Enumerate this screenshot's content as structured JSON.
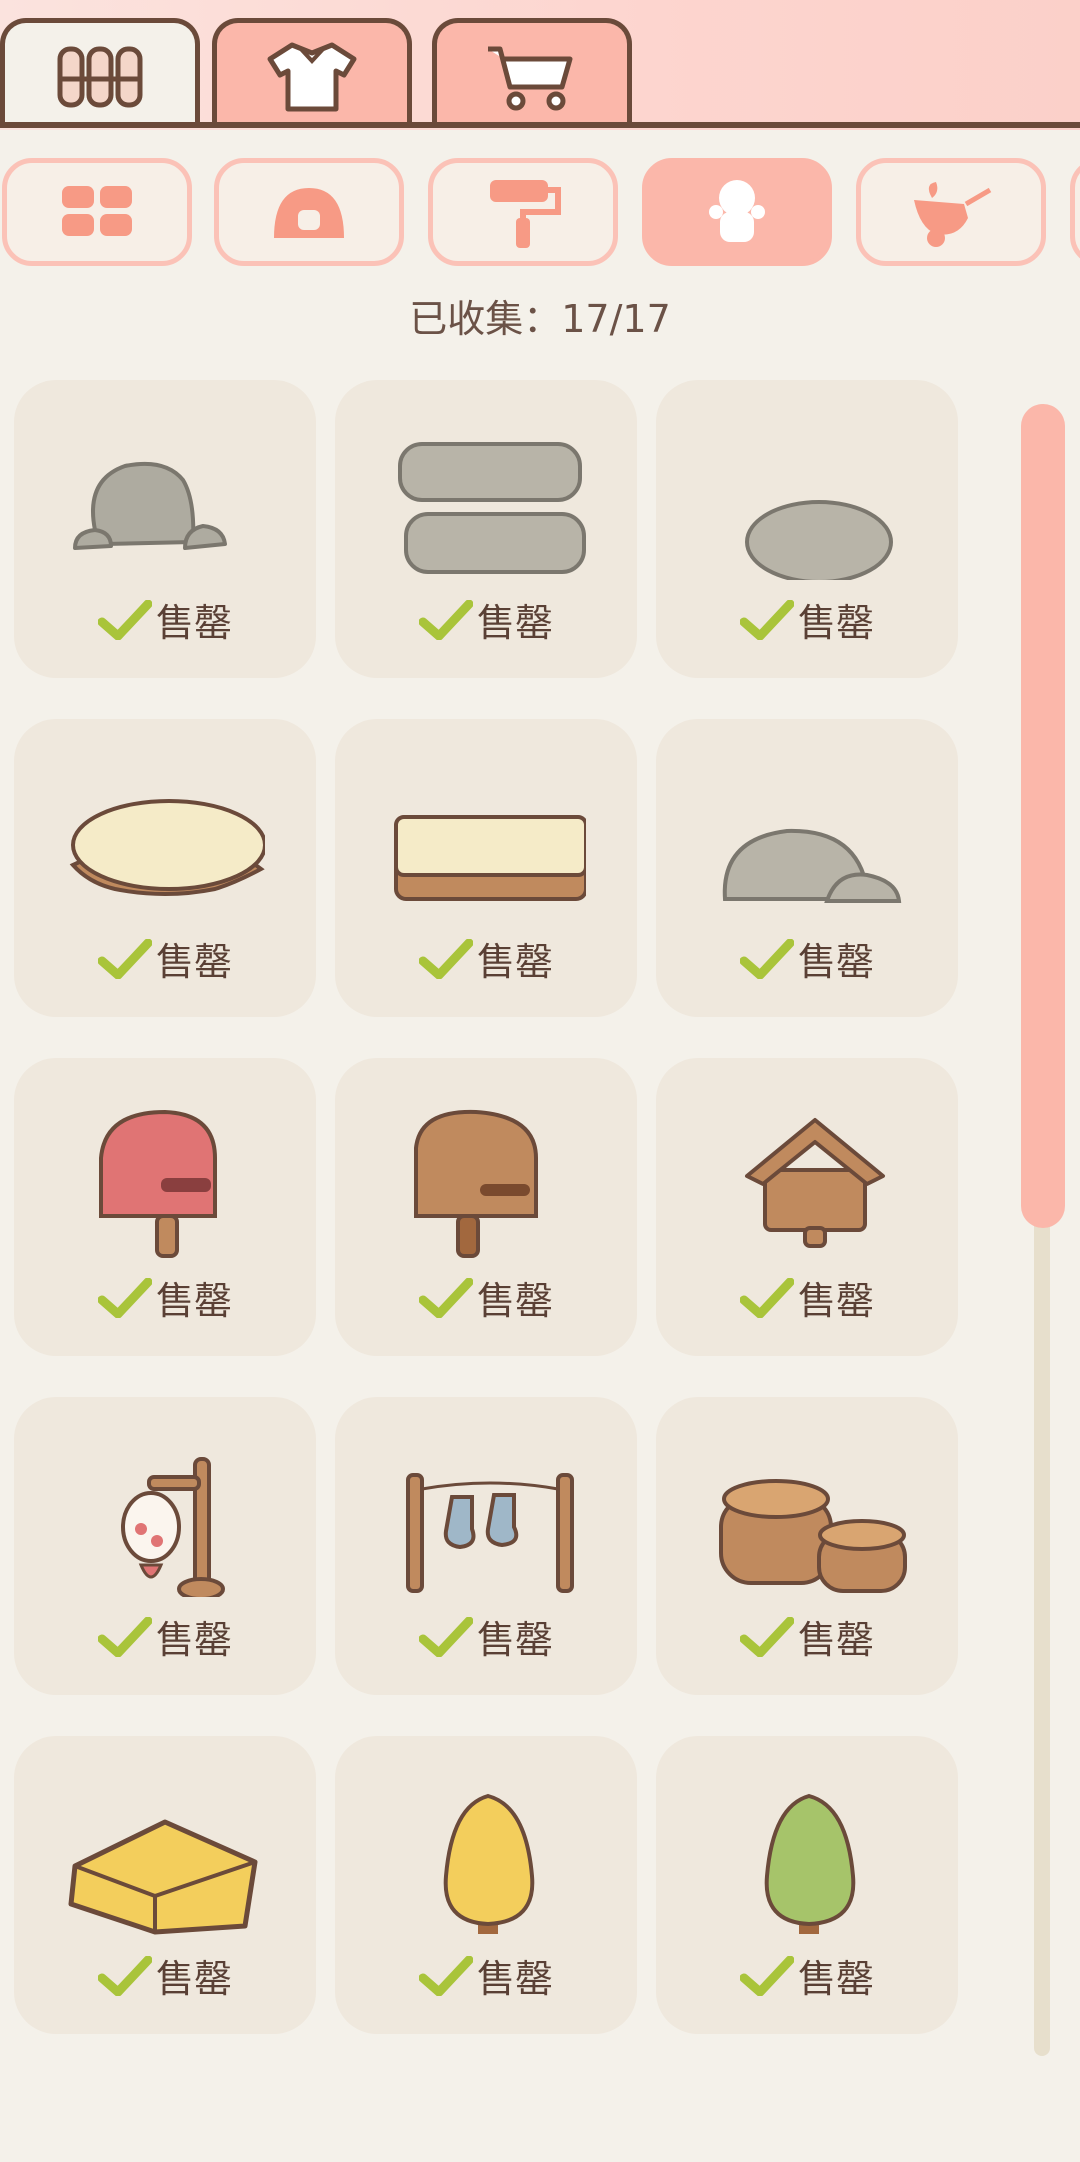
{
  "top_tabs": [
    {
      "icon": "fence-icon",
      "active": true
    },
    {
      "icon": "shirt-icon",
      "active": false
    },
    {
      "icon": "cart-icon",
      "active": false
    }
  ],
  "categories": [
    {
      "icon": "grid-icon",
      "active": false
    },
    {
      "icon": "rice-ball-icon",
      "active": false
    },
    {
      "icon": "paint-roller-icon",
      "active": false
    },
    {
      "icon": "character-icon",
      "active": true
    },
    {
      "icon": "bird-branch-icon",
      "active": false
    }
  ],
  "collection": {
    "label": "已收集：17/17"
  },
  "items": [
    {
      "icon": "rock-pile-icon",
      "status": "售罄"
    },
    {
      "icon": "stacked-logs-stone-icon",
      "status": "售罄"
    },
    {
      "icon": "flat-stone-icon",
      "status": "售罄"
    },
    {
      "icon": "tree-stump-icon",
      "status": "售罄"
    },
    {
      "icon": "wood-plank-icon",
      "status": "售罄"
    },
    {
      "icon": "boulders-icon",
      "status": "售罄"
    },
    {
      "icon": "red-mailbox-icon",
      "status": "售罄"
    },
    {
      "icon": "wooden-mailbox-icon",
      "status": "售罄"
    },
    {
      "icon": "birdhouse-icon",
      "status": "售罄"
    },
    {
      "icon": "lantern-post-icon",
      "status": "售罄"
    },
    {
      "icon": "sock-clothesline-icon",
      "status": "售罄"
    },
    {
      "icon": "barrels-icon",
      "status": "售罄"
    },
    {
      "icon": "hay-bale-icon",
      "status": "售罄"
    },
    {
      "icon": "yellow-tree-icon",
      "status": "售罄"
    },
    {
      "icon": "green-tree-icon",
      "status": "售罄"
    }
  ],
  "colors": {
    "accent": "#fbb7aa",
    "outline": "#6b4a3a",
    "check": "#a9c43a",
    "card": "#efe8dd",
    "background": "#f4f1ea"
  }
}
